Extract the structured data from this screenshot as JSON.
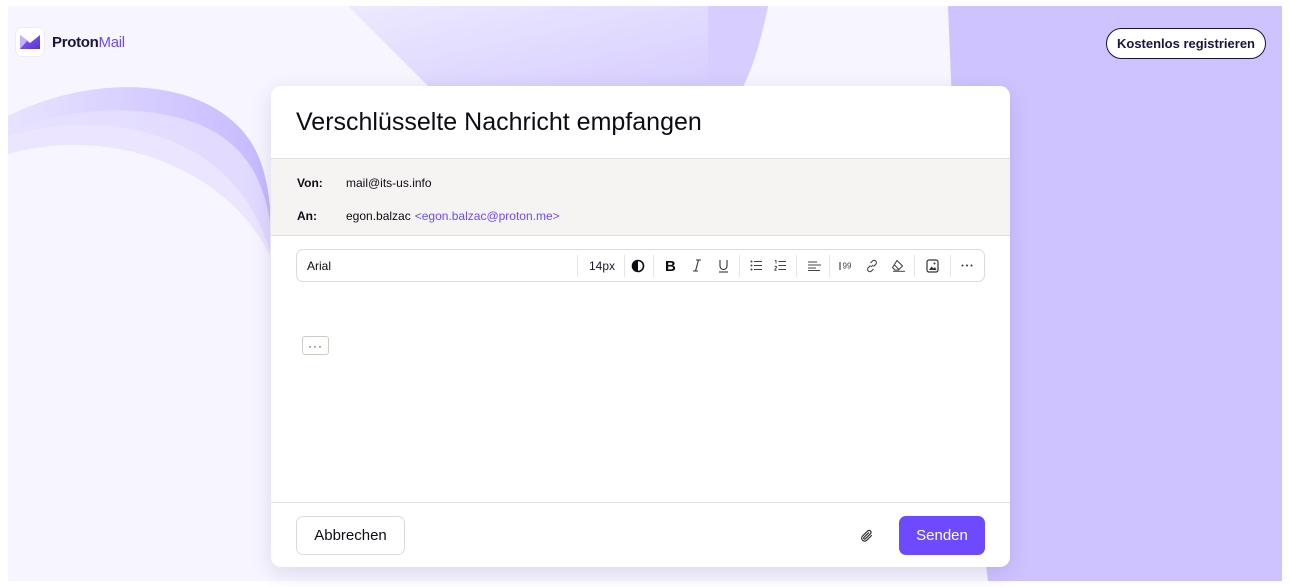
{
  "header": {
    "logo_brand": "Proton",
    "logo_product": "Mail",
    "register_label": "Kostenlos registrieren"
  },
  "message": {
    "title": "Verschlüsselte Nachricht empfangen",
    "from_label": "Von:",
    "from_value": "mail@its-us.info",
    "to_label": "An:",
    "to_name": "egon.balzac",
    "to_address": "<egon.balzac@proton.me>"
  },
  "toolbar": {
    "font_family": "Arial",
    "font_size": "14px",
    "icons": [
      "contrast-icon",
      "bold-icon",
      "italic-icon",
      "underline-icon",
      "bulleted-list-icon",
      "numbered-list-icon",
      "align-left-icon",
      "blockquote-icon",
      "link-icon",
      "clear-formatting-icon",
      "insert-image-icon",
      "more-options-icon"
    ]
  },
  "editor": {
    "ellipsis_label": "···"
  },
  "footer": {
    "cancel_label": "Abbrechen",
    "send_label": "Senden",
    "attach_icon": "paperclip-icon"
  },
  "colors": {
    "accent": "#6d4aff",
    "text": "#0c0c14",
    "meta_background": "#f5f4f2"
  }
}
